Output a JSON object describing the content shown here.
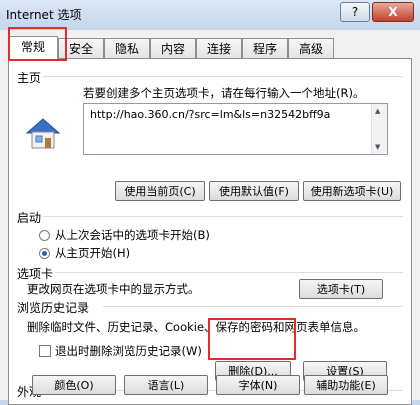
{
  "window": {
    "title": "Internet 选项",
    "help": "?",
    "close": "X"
  },
  "tabs": [
    "常规",
    "安全",
    "隐私",
    "内容",
    "连接",
    "程序",
    "高级"
  ],
  "home": {
    "legend": "主页",
    "description": "若要创建多个主页选项卡，请在每行输入一个地址(R)。",
    "url": "http://hao.360.cn/?src=lm&ls=n32542bff9a",
    "buttons": [
      "使用当前页(C)",
      "使用默认值(F)",
      "使用新选项卡(U)"
    ]
  },
  "startup": {
    "legend": "启动",
    "options": [
      "从上次会话中的选项卡开始(B)",
      "从主页开始(H)"
    ],
    "selected": 1
  },
  "tabsection": {
    "legend": "选项卡",
    "description": "更改网页在选项卡中的显示方式。",
    "button": "选项卡(T)"
  },
  "history": {
    "legend": "浏览历史记录",
    "description": "删除临时文件、历史记录、Cookie、保存的密码和网页表单信息。",
    "checkbox": "退出时删除浏览历史记录(W)",
    "delete": "删除(D)...",
    "settings": "设置(S)"
  },
  "appearance": {
    "legend": "外观",
    "buttons": [
      "颜色(O)",
      "语言(L)",
      "字体(N)",
      "辅助功能(E)"
    ]
  },
  "colors": {
    "highlight": "#e22b2b",
    "frame": "#c9d7ea",
    "accent": "#2b5fab"
  }
}
